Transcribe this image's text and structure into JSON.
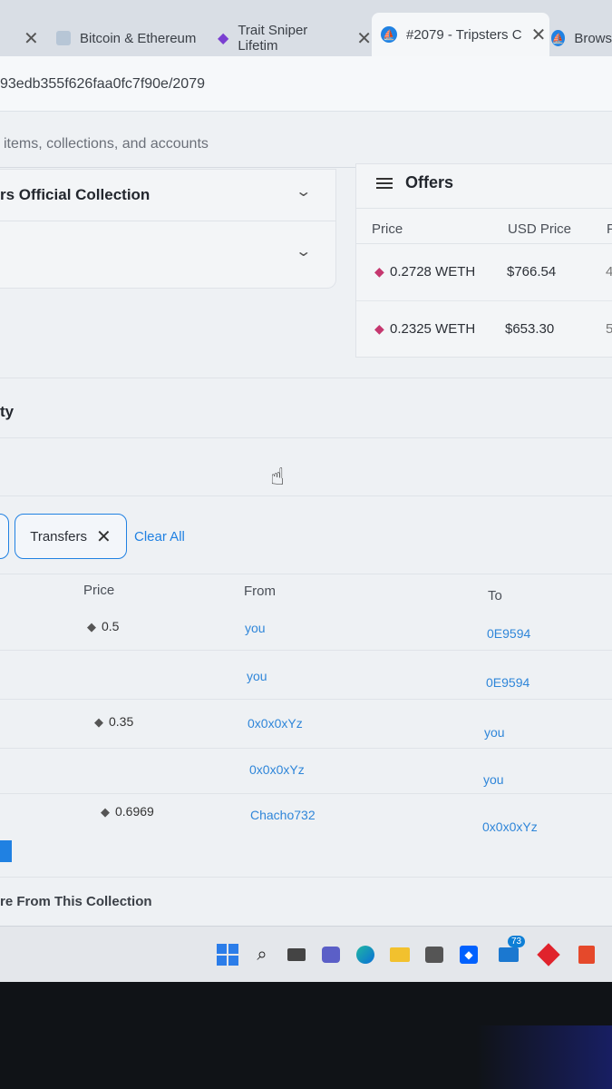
{
  "browser": {
    "tabs": [
      {
        "label": "",
        "close": "✕"
      },
      {
        "label": "Bitcoin & Ethereum",
        "close": ""
      },
      {
        "label": "Trait Sniper Lifetim",
        "close": "✕"
      },
      {
        "label": "#2079 - Tripsters C",
        "close": "✕"
      },
      {
        "label": "Brows",
        "close": ""
      }
    ],
    "url": "93edb355f626faa0fc7f90e/2079",
    "search_placeholder": "items, collections, and accounts"
  },
  "collection": {
    "title": "rs Official Collection"
  },
  "offers": {
    "title": "Offers",
    "columns": [
      "Price",
      "USD Price",
      "F"
    ],
    "rows": [
      {
        "price": "0.2728 WETH",
        "usd": "$766.54",
        "partial": "4"
      },
      {
        "price": "0.2325 WETH",
        "usd": "$653.30",
        "partial": "5"
      }
    ]
  },
  "activity": {
    "title": "ty",
    "filter_chip": "Transfers",
    "clear_all": "Clear All",
    "columns": [
      "Price",
      "From",
      "To"
    ],
    "rows": [
      {
        "price": "0.5",
        "from": "you",
        "to": "0E9594"
      },
      {
        "price": "",
        "from": "you",
        "to": "0E9594"
      },
      {
        "price": "0.35",
        "from": "0x0x0xYz",
        "to": "you"
      },
      {
        "price": "",
        "from": "0x0x0xYz",
        "to": "you"
      },
      {
        "price": "0.6969",
        "from": "Chacho732",
        "to": "0x0x0xYz"
      }
    ]
  },
  "more_section": "re From This Collection",
  "taskbar": {
    "icons": [
      "windows-icon",
      "search-icon",
      "task-view-icon",
      "teams-icon",
      "edge-icon",
      "file-explorer-icon",
      "store-icon",
      "dropbox-icon",
      "mail-icon",
      "app-red-icon",
      "office-icon"
    ],
    "mail_badge": "73"
  },
  "colors": {
    "accent": "#2081e2",
    "eth_pink": "#c5376f"
  }
}
